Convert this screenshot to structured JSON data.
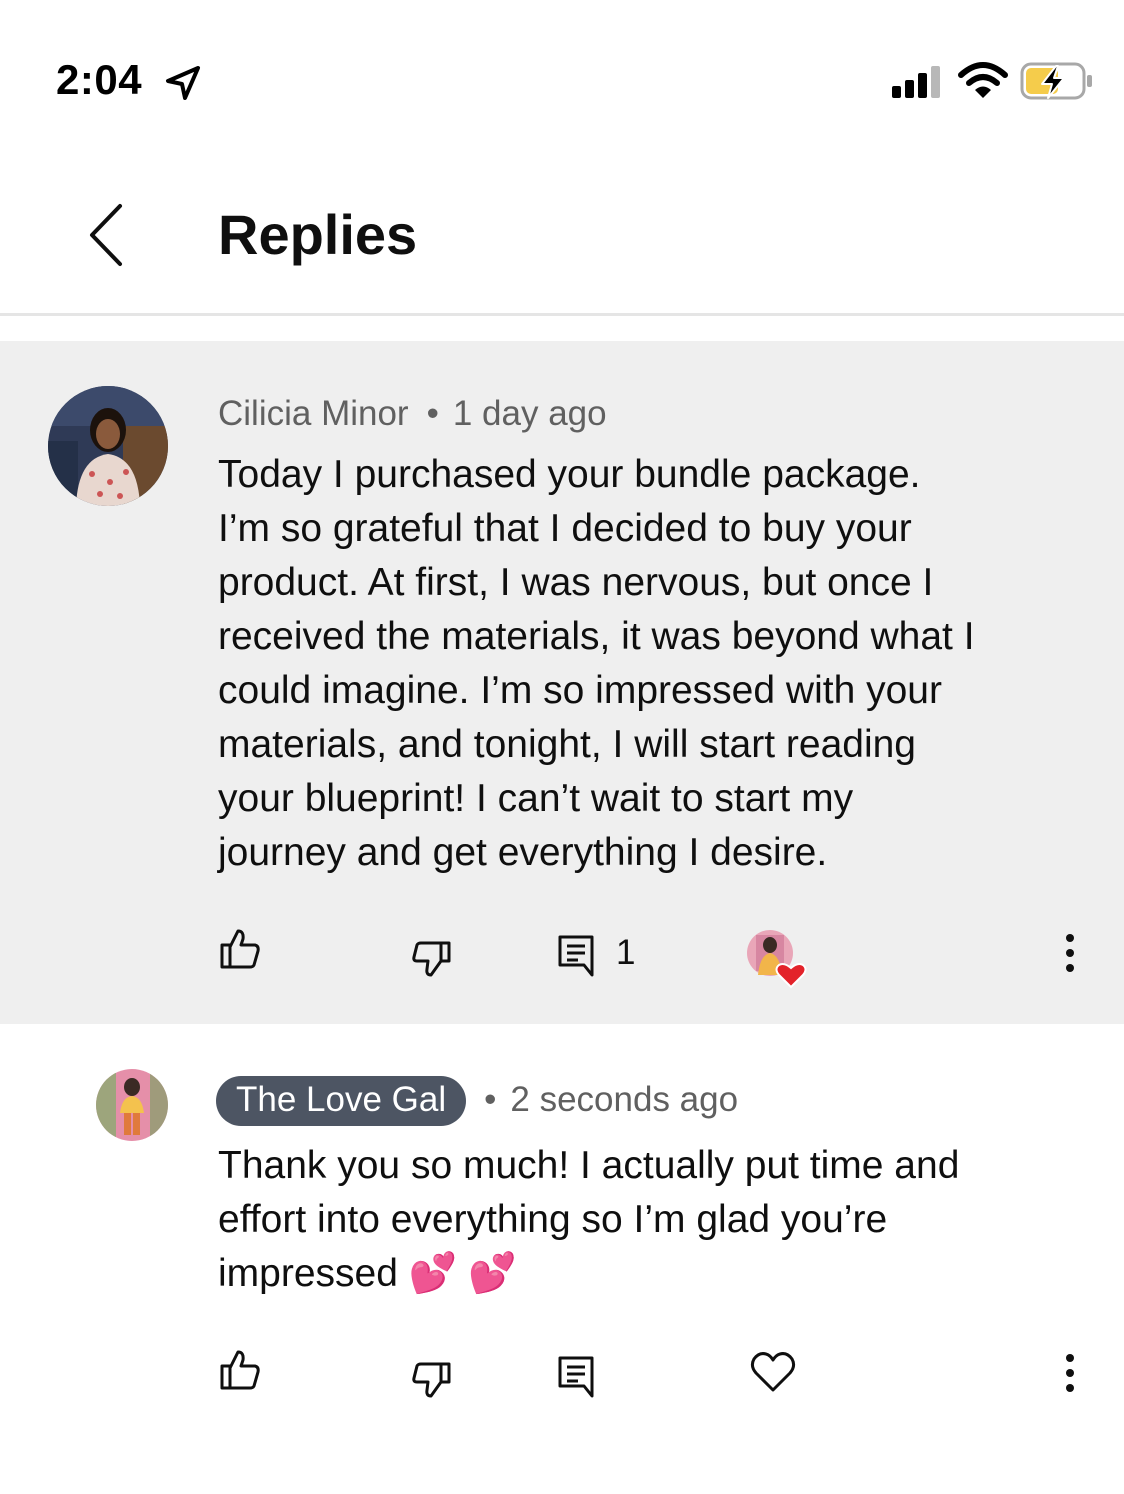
{
  "status_bar": {
    "time": "2:04",
    "icons": [
      "location-arrow-icon",
      "signal-bars-icon",
      "wifi-icon",
      "battery-charging-icon"
    ],
    "battery_color": "#f5cc4b"
  },
  "header": {
    "title": "Replies",
    "back_icon": "chevron-left-icon"
  },
  "comment": {
    "author": "Cilicia Minor",
    "separator": "•",
    "time": "1 day ago",
    "lines": [
      "Today I purchased your bundle package.",
      " I’m so grateful that I decided to buy your",
      "product.  At first, I was nervous, but once I",
      "received the materials, it was beyond what I",
      "could imagine.  I’m so impressed with your",
      "materials, and tonight, I will start reading",
      "your blueprint!  I can’t wait to start my",
      "journey and get everything I desire."
    ],
    "reply_count": "1",
    "background": "#efefef",
    "actions": [
      "thumbs-up-icon",
      "thumbs-down-icon",
      "reply-icon",
      "creator-heart-icon",
      "more-vert-icon"
    ]
  },
  "reply": {
    "author": "The Love Gal",
    "separator": "•",
    "time": "2 seconds ago",
    "lines": [
      "Thank you so much! I actually put time and",
      "effort into everything so I’m glad you’re",
      "impressed 💕 💕"
    ],
    "badge_color": "#4d5563",
    "actions": [
      "thumbs-up-icon",
      "thumbs-down-icon",
      "reply-icon",
      "heart-outline-icon",
      "more-vert-icon"
    ]
  }
}
